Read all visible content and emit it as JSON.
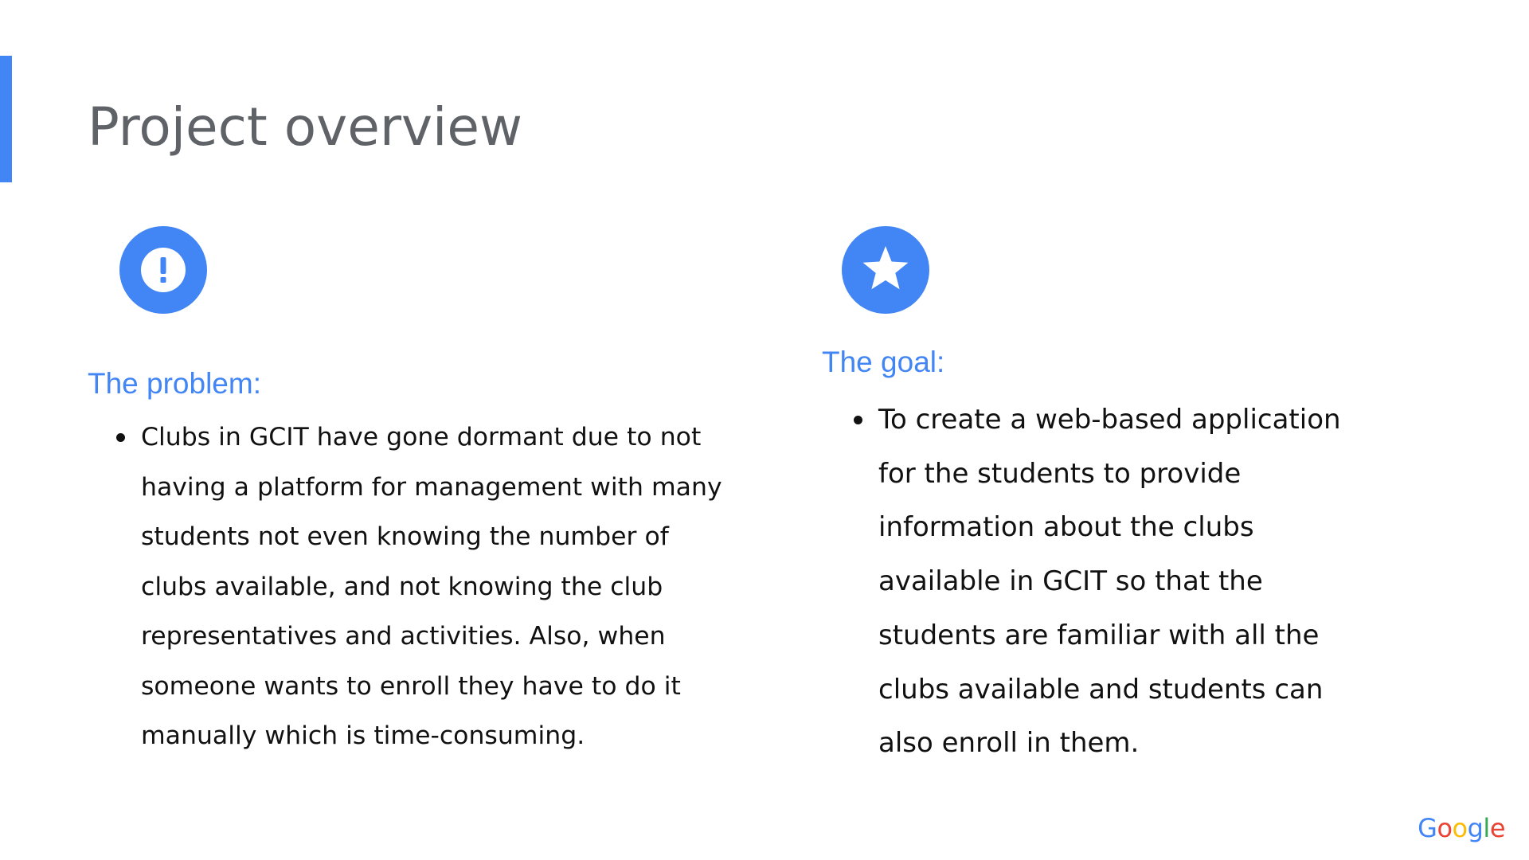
{
  "slide": {
    "title": "Project overview",
    "accent_color": "#4285f4",
    "title_color": "#5f6368"
  },
  "problem": {
    "icon": "exclamation-circle-icon",
    "heading": "The problem:",
    "bullets": [
      "Clubs in GCIT have gone dormant due to not having a platform for management with many students not even knowing the number of clubs available, and not knowing the club representatives and activities. Also, when someone wants to enroll they have to do it manually which is time-consuming."
    ]
  },
  "goal": {
    "icon": "star-circle-icon",
    "heading": "The goal:",
    "bullets": [
      "To create a web-based application for the students to provide information about the clubs available in GCIT so that the students are familiar with all the clubs available and students can also enroll in them."
    ]
  },
  "logo": {
    "letters": [
      "G",
      "o",
      "o",
      "g",
      "l",
      "e"
    ],
    "colors": [
      "#4285f4",
      "#ea4335",
      "#fbbc05",
      "#4285f4",
      "#34a853",
      "#ea4335"
    ]
  }
}
